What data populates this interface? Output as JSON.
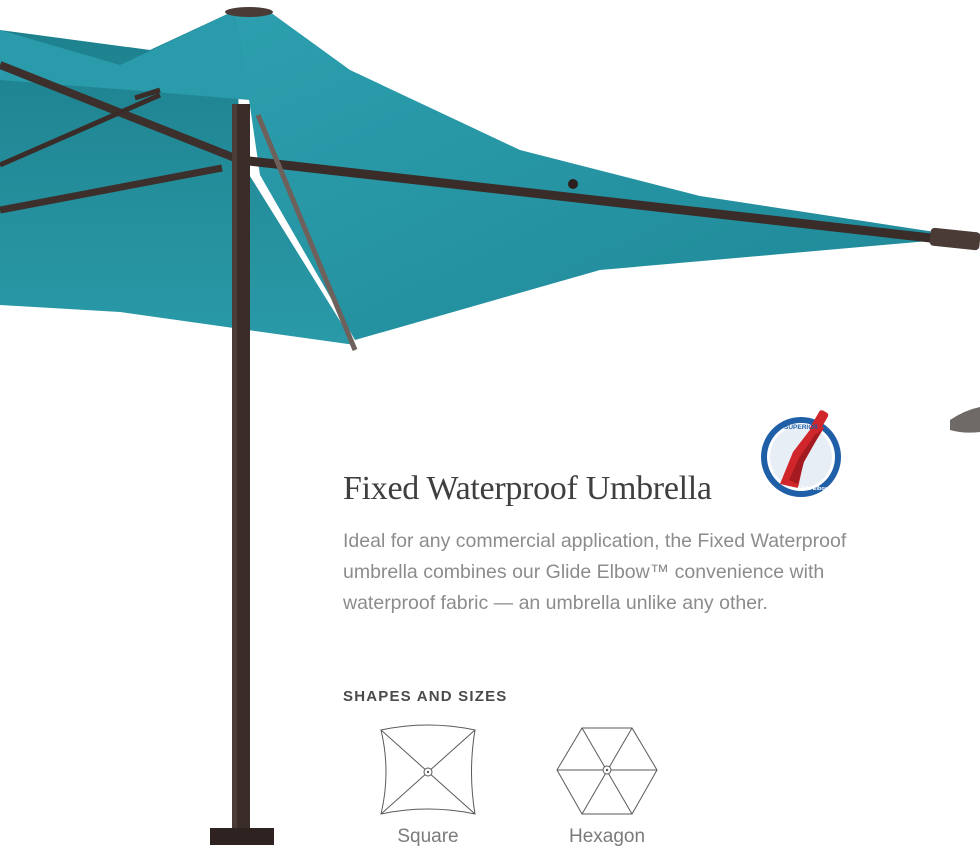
{
  "product": {
    "title": "Fixed Waterproof Umbrella",
    "description": "Ideal for any commercial application, the Fixed Waterproof umbrella combines our Glide Elbow™ convenience with waterproof fabric — an umbrella unlike any other.",
    "badge": {
      "icon": "glide-elbow-badge-icon",
      "top_text": "SUPERIOR",
      "bottom_text": "Glide Elbow™"
    }
  },
  "shapes": {
    "heading": "SHAPES AND SIZES",
    "items": [
      {
        "label": "Square",
        "icon": "square-canopy-icon"
      },
      {
        "label": "Hexagon",
        "icon": "hexagon-canopy-icon"
      }
    ]
  },
  "colors": {
    "canopy": "#2797a6",
    "frame": "#3a2c28",
    "title": "#3f3f3f",
    "body_text": "#8c8c8c",
    "badge_blue": "#1f5fa8",
    "badge_red": "#d0262b"
  }
}
